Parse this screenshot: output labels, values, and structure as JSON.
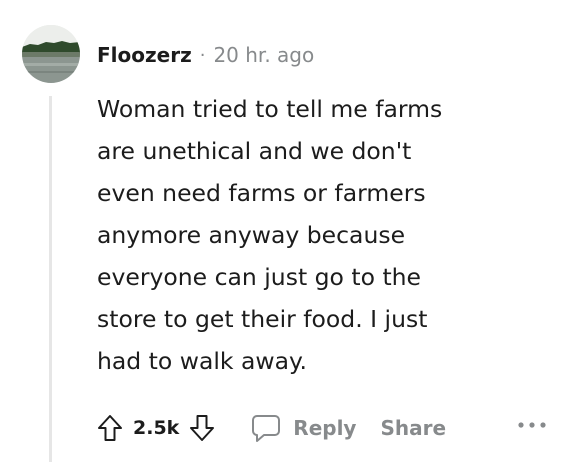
{
  "comment": {
    "author": "Floozerz",
    "separator": "·",
    "time": "20 hr. ago",
    "body": "Woman tried to tell me farms\nare unethical and we don't\neven need farms or farmers\nanymore anyway because\neveryone can just go to the\nstore to get their food. I just\nhad to walk away.",
    "score": "2.5k",
    "reply_label": "Reply",
    "share_label": "Share"
  },
  "icons": {
    "avatar": "landscape-avatar",
    "upvote": "upvote-arrow-icon",
    "downvote": "downvote-arrow-icon",
    "reply": "speech-bubble-icon",
    "more": "ellipsis-icon"
  },
  "colors": {
    "text": "#1c1c1c",
    "muted": "#878a8c",
    "thread_line": "#e6e6e6"
  }
}
